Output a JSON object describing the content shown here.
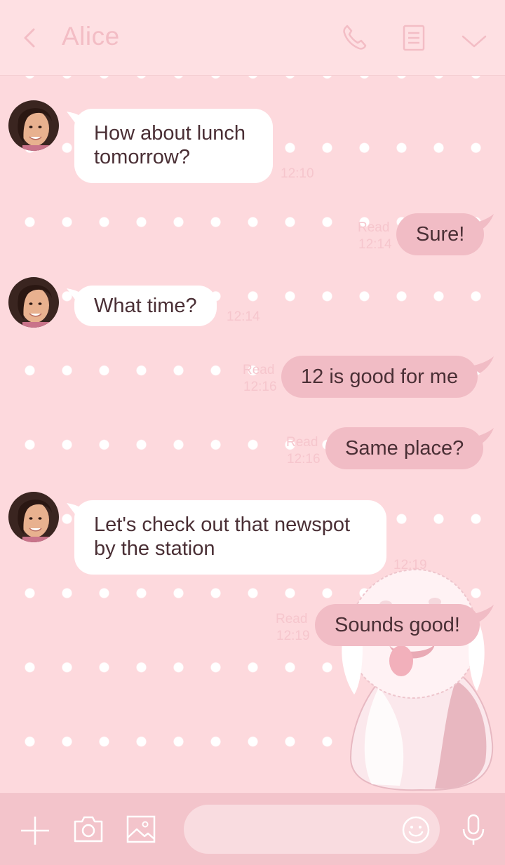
{
  "header": {
    "back_icon": "chevron-left-icon",
    "contact_name": "Alice",
    "call_icon": "phone-icon",
    "notes_icon": "notes-icon",
    "menu_icon": "chevron-down-icon"
  },
  "messages": [
    {
      "side": "left",
      "text": "How about lunch tomorrow?",
      "time": "12:10"
    },
    {
      "side": "right",
      "text": "Sure!",
      "read": "Read",
      "time": "12:14"
    },
    {
      "side": "left",
      "text": "What time?",
      "time": "12:14"
    },
    {
      "side": "right",
      "text": "12 is good for me",
      "read": "Read",
      "time": "12:16"
    },
    {
      "side": "right",
      "text": "Same place?",
      "read": "Read",
      "time": "12:16"
    },
    {
      "side": "left",
      "text": "Let's check out that newspot by the station",
      "time": "12:19"
    },
    {
      "side": "right",
      "text": "Sounds good!",
      "read": "Read",
      "time": "12:19"
    }
  ],
  "footer": {
    "plus_icon": "plus-icon",
    "camera_icon": "camera-icon",
    "image_icon": "image-icon",
    "input_value": "",
    "emoji_icon": "smiley-icon",
    "mic_icon": "microphone-icon"
  },
  "colors": {
    "background": "#fdd9dd",
    "header": "#fee0e3",
    "outgoing_bubble": "#f1bcc5",
    "incoming_bubble": "#ffffff",
    "text": "#4a2f35",
    "meta_text": "#f6c6cd",
    "footer": "#f3c4cb"
  }
}
